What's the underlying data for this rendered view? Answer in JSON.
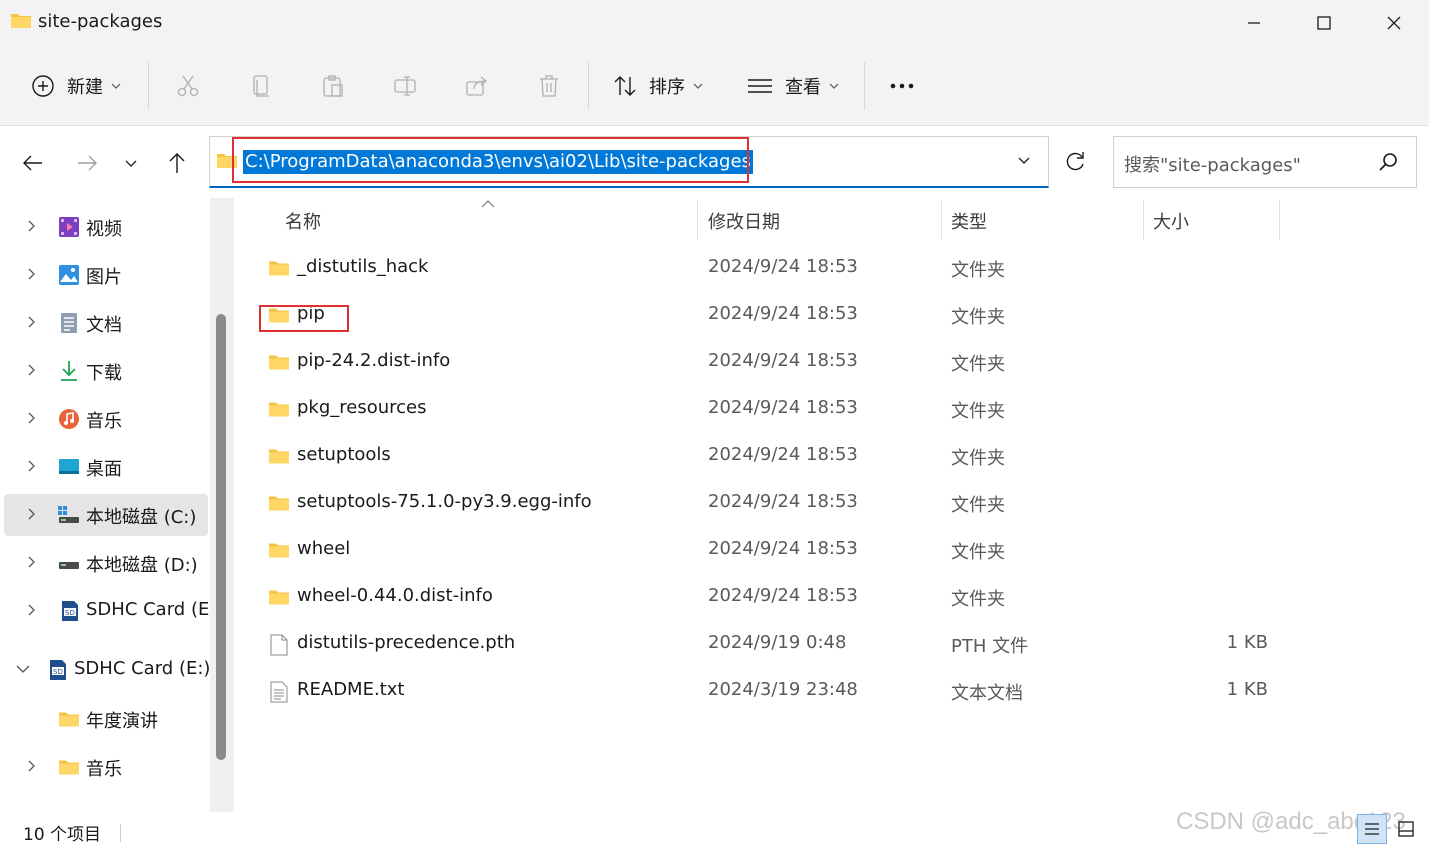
{
  "window": {
    "title": "site-packages"
  },
  "toolbar": {
    "new_label": "新建",
    "sort_label": "排序",
    "view_label": "查看"
  },
  "nav": {
    "address": "C:\\ProgramData\\anaconda3\\envs\\ai02\\Lib\\site-packages",
    "search_placeholder": "搜索\"site-packages\""
  },
  "sidebar": {
    "items": [
      {
        "label": "视频",
        "icon": "video-icon"
      },
      {
        "label": "图片",
        "icon": "pictures-icon"
      },
      {
        "label": "文档",
        "icon": "documents-icon"
      },
      {
        "label": "下载",
        "icon": "download-icon"
      },
      {
        "label": "音乐",
        "icon": "music-icon"
      },
      {
        "label": "桌面",
        "icon": "desktop-icon"
      },
      {
        "label": "本地磁盘 (C:)",
        "icon": "drive-icon",
        "selected": true
      },
      {
        "label": "本地磁盘 (D:)",
        "icon": "drive-icon"
      },
      {
        "label": "SDHC Card (E:",
        "icon": "sd-card-icon"
      },
      {
        "label": "SDHC Card (E:)",
        "icon": "sd-card-icon",
        "expanded": true
      },
      {
        "label": "年度演讲",
        "icon": "folder-icon"
      },
      {
        "label": "音乐",
        "icon": "folder-icon"
      }
    ]
  },
  "columns": {
    "name": "名称",
    "date": "修改日期",
    "type": "类型",
    "size": "大小"
  },
  "files": [
    {
      "name": "_distutils_hack",
      "date": "2024/9/24 18:53",
      "type": "文件夹",
      "size": "",
      "kind": "folder"
    },
    {
      "name": "pip",
      "date": "2024/9/24 18:53",
      "type": "文件夹",
      "size": "",
      "kind": "folder"
    },
    {
      "name": "pip-24.2.dist-info",
      "date": "2024/9/24 18:53",
      "type": "文件夹",
      "size": "",
      "kind": "folder"
    },
    {
      "name": "pkg_resources",
      "date": "2024/9/24 18:53",
      "type": "文件夹",
      "size": "",
      "kind": "folder"
    },
    {
      "name": "setuptools",
      "date": "2024/9/24 18:53",
      "type": "文件夹",
      "size": "",
      "kind": "folder"
    },
    {
      "name": "setuptools-75.1.0-py3.9.egg-info",
      "date": "2024/9/24 18:53",
      "type": "文件夹",
      "size": "",
      "kind": "folder"
    },
    {
      "name": "wheel",
      "date": "2024/9/24 18:53",
      "type": "文件夹",
      "size": "",
      "kind": "folder"
    },
    {
      "name": "wheel-0.44.0.dist-info",
      "date": "2024/9/24 18:53",
      "type": "文件夹",
      "size": "",
      "kind": "folder"
    },
    {
      "name": "distutils-precedence.pth",
      "date": "2024/9/19 0:48",
      "type": "PTH 文件",
      "size": "1 KB",
      "kind": "file"
    },
    {
      "name": "README.txt",
      "date": "2024/3/19 23:48",
      "type": "文本文档",
      "size": "1 KB",
      "kind": "text"
    }
  ],
  "status": {
    "count": "10 个项目"
  },
  "watermark": "CSDN @adc_abc123",
  "colors": {
    "accent": "#0078d7",
    "highlight_box": "#e03030",
    "folder": "#f5c342"
  }
}
